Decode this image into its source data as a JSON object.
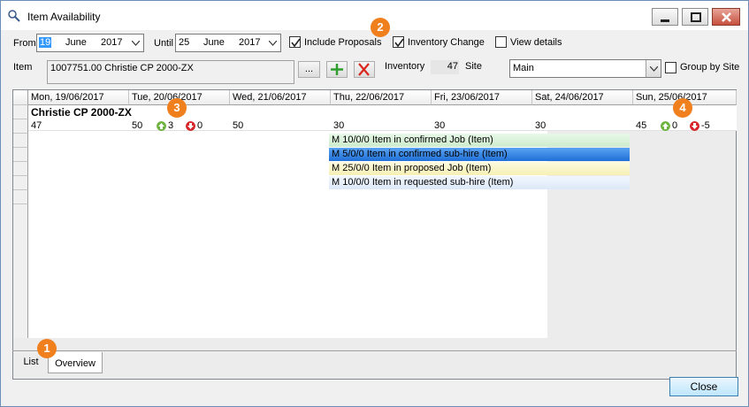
{
  "window": {
    "title": "Item Availability"
  },
  "filters": {
    "from_label": "From",
    "from_day": "19",
    "from_month": "June",
    "from_year": "2017",
    "until_label": "Until",
    "until_day": "25",
    "until_month": "June",
    "until_year": "2017",
    "include_proposals_label": "Include Proposals",
    "include_proposals_checked": true,
    "inventory_change_label": "Inventory Change",
    "inventory_change_checked": true,
    "view_details_label": "View details",
    "view_details_checked": false
  },
  "item": {
    "label": "Item",
    "value": "1007751.00 Christie CP 2000-ZX",
    "browse_label": "...",
    "inventory_label": "Inventory",
    "inventory_value": "47",
    "site_label": "Site",
    "site_value": "Main",
    "group_by_site_label": "Group by Site",
    "group_by_site_checked": false
  },
  "grid": {
    "columns": [
      "Mon, 19/06/2017",
      "Tue, 20/06/2017",
      "Wed, 21/06/2017",
      "Thu, 22/06/2017",
      "Fri, 23/06/2017",
      "Sat, 24/06/2017",
      "Sun, 25/06/2017"
    ],
    "group_title": "Christie CP 2000-ZX",
    "values": [
      "47",
      "50",
      "50",
      "30",
      "30",
      "30",
      "45"
    ],
    "tue_up": "3",
    "tue_down": "0",
    "sun_up": "0",
    "sun_down": "-5",
    "legend": [
      {
        "text": "M 10/0/0 Item in confirmed Job (Item)",
        "color": "#d9f2d9"
      },
      {
        "text": "M 5/0/0 Item in confirmed sub-hire (Item)",
        "color": "#2b7de9"
      },
      {
        "text": "M 25/0/0 Item in proposed Job (Item)",
        "color": "#fbf6c8"
      },
      {
        "text": "M 10/0/0 Item in requested sub-hire (Item)",
        "color": "#e4eefa"
      }
    ]
  },
  "tabs": {
    "list": "List",
    "overview": "Overview"
  },
  "callouts": {
    "one": "1",
    "two": "2",
    "three": "3",
    "four": "4"
  },
  "footer": {
    "close_label": "Close"
  },
  "colors": {
    "callout": "#f07f1e",
    "up_arrow": "#6db33f",
    "down_arrow": "#d7262b"
  }
}
